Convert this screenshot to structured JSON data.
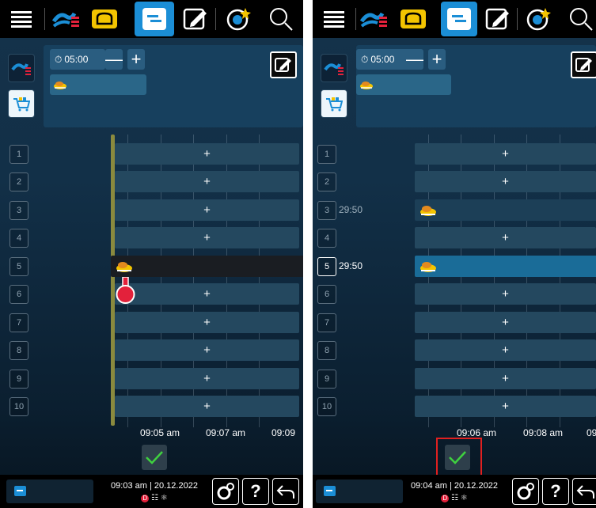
{
  "panels": [
    {
      "timer": "05:00",
      "rows": [
        {
          "num": "1",
          "time": "",
          "slot": "+"
        },
        {
          "num": "2",
          "time": "",
          "slot": "+"
        },
        {
          "num": "3",
          "time": "",
          "slot": "+"
        },
        {
          "num": "4",
          "time": "",
          "slot": "+"
        },
        {
          "num": "5",
          "time": "",
          "slot": ""
        },
        {
          "num": "6",
          "time": "",
          "slot": "+"
        },
        {
          "num": "7",
          "time": "",
          "slot": "+"
        },
        {
          "num": "8",
          "time": "",
          "slot": "+"
        },
        {
          "num": "9",
          "time": "",
          "slot": "+"
        },
        {
          "num": "10",
          "time": "",
          "slot": "+"
        }
      ],
      "ticks": [
        "09:05 am",
        "09:07 am",
        "09:09"
      ],
      "status_time": "09:03 am | 20.12.2022"
    },
    {
      "timer": "05:00",
      "rows": [
        {
          "num": "1",
          "time": "",
          "slot": "+"
        },
        {
          "num": "2",
          "time": "",
          "slot": "+"
        },
        {
          "num": "3",
          "time": "29:50",
          "slot": ""
        },
        {
          "num": "4",
          "time": "",
          "slot": "+"
        },
        {
          "num": "5",
          "time": "29:50",
          "slot": ""
        },
        {
          "num": "6",
          "time": "",
          "slot": "+"
        },
        {
          "num": "7",
          "time": "",
          "slot": "+"
        },
        {
          "num": "8",
          "time": "",
          "slot": "+"
        },
        {
          "num": "9",
          "time": "",
          "slot": "+"
        },
        {
          "num": "10",
          "time": "",
          "slot": "+"
        }
      ],
      "ticks": [
        "09:06 am",
        "09:08 am",
        "09"
      ],
      "status_time": "09:04 am | 20.12.2022"
    }
  ],
  "icons": {
    "menu": "hamburger-menu-icon",
    "cooking": "cooking-paths-icon",
    "bread": "bread-icon",
    "planner": "planner-icon",
    "edit": "edit-icon",
    "favorites": "favorites-icon",
    "search": "search-icon",
    "cart": "basket-icon",
    "food": "food-item-icon",
    "probe": "core-probe-icon",
    "confirm": "checkmark-icon",
    "settings": "settings-icon",
    "help": "help-icon",
    "back": "back-icon"
  },
  "colors": {
    "active": "#1b8ed6",
    "probe": "#e3213b",
    "highlight": "#e02020"
  }
}
